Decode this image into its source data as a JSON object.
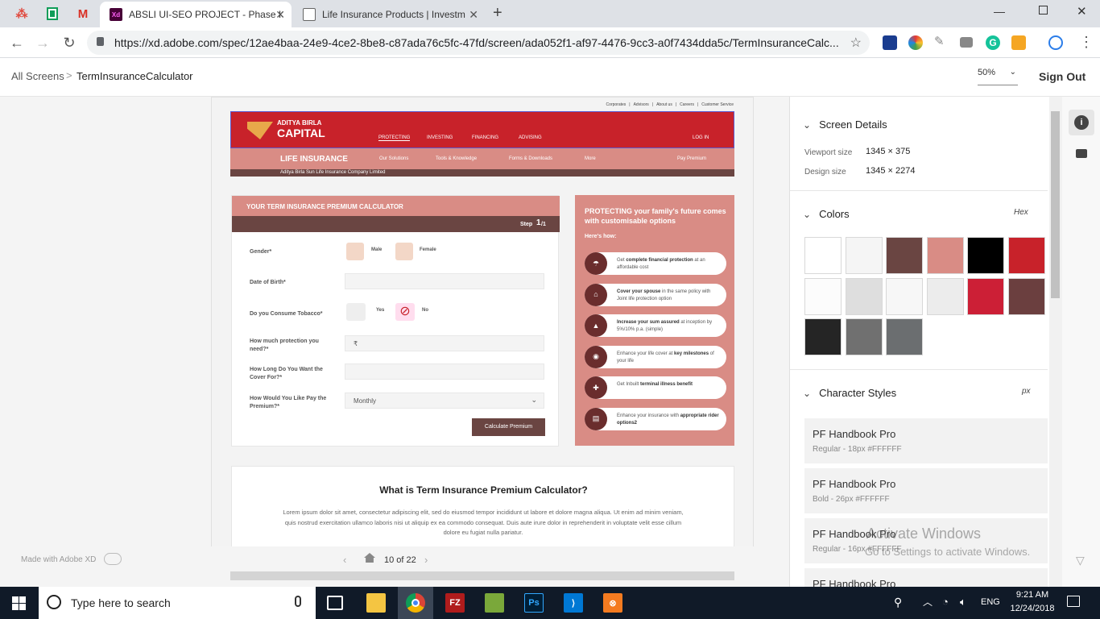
{
  "browser": {
    "tabs": [
      {
        "title": "ABSLI UI-SEO PROJECT - Phase I",
        "active": true
      },
      {
        "title": "Life Insurance Products | Investm",
        "active": false
      }
    ],
    "url": "https://xd.adobe.com/spec/12ae4baa-24e9-4ce2-8be8-c87ada76c5fc-47fd/screen/ada052f1-af97-4476-9cc3-a0f7434dda5c/TermInsuranceCalc..."
  },
  "xd_header": {
    "breadcrumb_root": "All Screens",
    "breadcrumb_sep": ">",
    "screen_name": "TermInsuranceCalculator",
    "zoom": "50%",
    "sign_out": "Sign Out"
  },
  "design": {
    "top_links": [
      "Corporates",
      "Advisors",
      "About us",
      "Careers",
      "Customer Service"
    ],
    "logo_line1": "ADITYA BIRLA",
    "logo_line2": "CAPITAL",
    "main_nav": [
      "PROTECTING",
      "INVESTING",
      "FINANCING",
      "ADVISING"
    ],
    "login": "LOG IN",
    "life_insurance": "LIFE INSURANCE",
    "sub_nav": [
      "Our Solutions",
      "Tools & Knowledge",
      "Forms & Downloads",
      "More"
    ],
    "pay_premium": "Pay Premium",
    "company": "Aditya Birla Sun Life Insurance Company Limited",
    "calc_title": "YOUR TERM INSURANCE PREMIUM CALCULATOR",
    "step_label": "Step",
    "step_num": "1",
    "step_total": "/1",
    "gender_label": "Gender*",
    "male": "Male",
    "female": "Female",
    "dob_label": "Date of Birth*",
    "tobacco_label": "Do you Consume Tobacco*",
    "yes": "Yes",
    "no": "No",
    "protection_label": "How much protection you need?*",
    "rupee": "₹",
    "cover_label": "How Long Do You Want the Cover For?*",
    "pay_label": "How Would You Like Pay the Premium?*",
    "pay_value": "Monthly",
    "calc_button": "Calculate Premium",
    "side_title": "PROTECTING your family's future comes with customisable options",
    "side_sub": "Here's how:",
    "features": [
      {
        "pre": "Get ",
        "bold": "complete financial protection",
        "post": " at an affordable cost"
      },
      {
        "pre": "",
        "bold": "Cover your spouse",
        "post": " in the same policy with Joint life protection option"
      },
      {
        "pre": "",
        "bold": "Increase your sum assured",
        "post": " at inception by 5%/10% p.a. (simple)"
      },
      {
        "pre": "Enhance your life cover at ",
        "bold": "key milestones",
        "post": " of your life"
      },
      {
        "pre": "Get Inbuilt ",
        "bold": "terminal illness benefit",
        "post": ""
      },
      {
        "pre": "Enhance your insurance with ",
        "bold": "appropriate rider options2",
        "post": ""
      }
    ],
    "what_title": "What is Term Insurance Premium Calculator?",
    "what_body": "Lorem ipsum dolor sit amet, consectetur adipiscing elit, sed do eiusmod tempor incididunt ut labore et dolore magna aliqua. Ut enim ad minim veniam, quis nostrud exercitation ullamco laboris nisi ut aliquip ex ea commodo consequat. Duis aute irure dolor in reprehenderit in voluptate velit esse cillum dolore eu fugiat nulla pariatur."
  },
  "footer": {
    "made_with": "Made with Adobe XD",
    "pager": "10 of 22"
  },
  "panel": {
    "screen_details": "Screen Details",
    "viewport_label": "Viewport size",
    "viewport_value": "1345 × 375",
    "design_label": "Design size",
    "design_value": "1345 × 2274",
    "colors": "Colors",
    "colors_format": "Hex",
    "swatches": [
      "#ffffff",
      "#f5f5f5",
      "#6a4542",
      "#d98c85",
      "#000000",
      "#c8222a",
      "#fcfcfc",
      "#dedede",
      "#f7f7f7",
      "#ececec",
      "#cc1f36",
      "#6b3f3f",
      "#252525",
      "#707070",
      "#6b6e70"
    ],
    "char_styles": "Character Styles",
    "char_format": "px",
    "styles": [
      {
        "name": "PF Handbook Pro",
        "meta": "Regular - 18px #FFFFFF"
      },
      {
        "name": "PF Handbook Pro",
        "meta": "Bold - 26px #FFFFFF"
      },
      {
        "name": "PF Handbook Pro",
        "meta": "Regular - 16px #FFFFFF"
      },
      {
        "name": "PF Handbook Pro",
        "meta": ""
      }
    ]
  },
  "watermark": {
    "line1": "Activate Windows",
    "line2": "Go to Settings to activate Windows."
  },
  "taskbar": {
    "search": "Type here to search",
    "lang": "ENG",
    "time": "9:21 AM",
    "date": "12/24/2018"
  }
}
